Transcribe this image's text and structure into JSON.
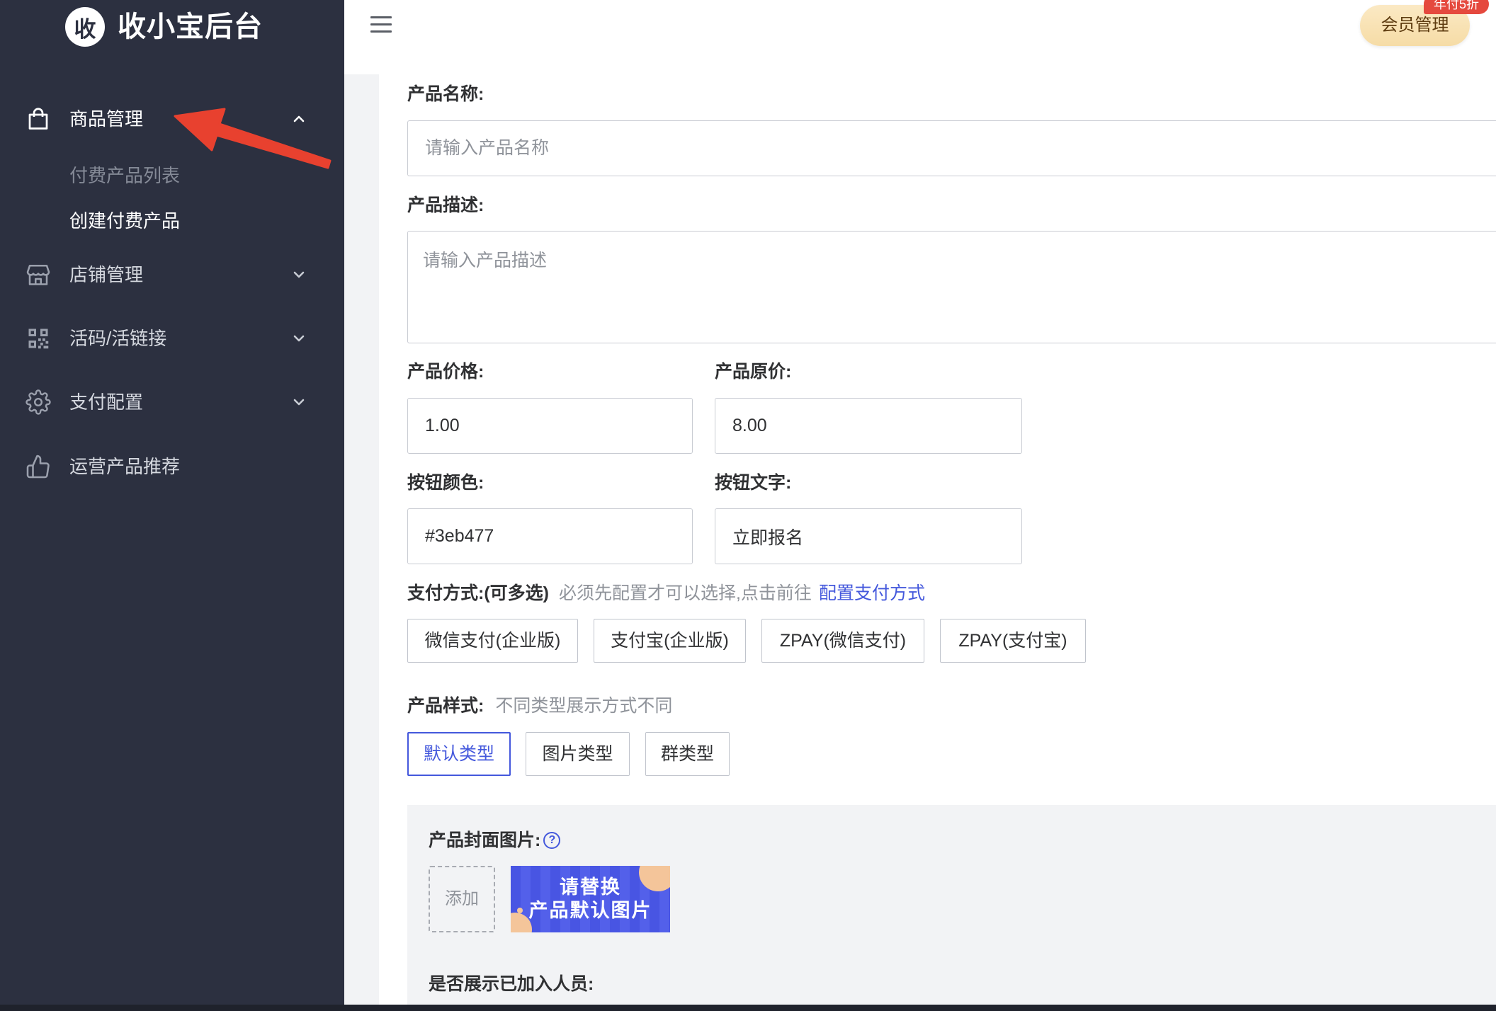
{
  "theme": {
    "sidebar_bg": "#2c3040",
    "accent": "#4458dc",
    "annotation_arrow": "#e8412f",
    "badge_bg": "#e5493e",
    "member_button_bg": "#f6dca6"
  },
  "app": {
    "logo_char": "收",
    "title": "收小宝后台"
  },
  "sidebar": {
    "menus": [
      {
        "label": "商品管理",
        "icon": "shopping-bag-icon",
        "expanded": true,
        "children": [
          "付费产品列表",
          "创建付费产品"
        ],
        "active_child": 1
      },
      {
        "label": "店铺管理",
        "icon": "store-icon",
        "expanded": false
      },
      {
        "label": "活码/活链接",
        "icon": "qrcode-icon",
        "expanded": false
      },
      {
        "label": "支付配置",
        "icon": "gear-icon",
        "expanded": false
      },
      {
        "label": "运营产品推荐",
        "icon": "thumbs-up-icon"
      }
    ]
  },
  "header": {
    "menu_icon": "hamburger-icon",
    "member_button": "会员管理",
    "member_badge": "年付5折"
  },
  "form": {
    "name": {
      "label": "产品名称:",
      "placeholder": "请输入产品名称"
    },
    "description": {
      "label": "产品描述:",
      "placeholder": "请输入产品描述"
    },
    "price": {
      "label": "产品价格:",
      "value": "1.00"
    },
    "original_price": {
      "label": "产品原价:",
      "value": "8.00"
    },
    "button_color": {
      "label": "按钮颜色:",
      "value": "#3eb477"
    },
    "button_text": {
      "label": "按钮文字:",
      "value": "立即报名"
    },
    "payment": {
      "label": "支付方式:(可多选)",
      "hint": "必须先配置才可以选择,点击前往",
      "link": "配置支付方式",
      "options": [
        "微信支付(企业版)",
        "支付宝(企业版)",
        "ZPAY(微信支付)",
        "ZPAY(支付宝)"
      ]
    },
    "style": {
      "label": "产品样式:",
      "hint": "不同类型展示方式不同",
      "options": [
        "默认类型",
        "图片类型",
        "群类型"
      ],
      "selected": 0
    },
    "cover": {
      "label": "产品封面图片:",
      "help_icon": "question-circle-icon",
      "add_label": "添加",
      "image_line1": "请替换",
      "image_line2": "产品默认图片"
    },
    "show_members": {
      "label": "是否展示已加入人员:"
    }
  }
}
